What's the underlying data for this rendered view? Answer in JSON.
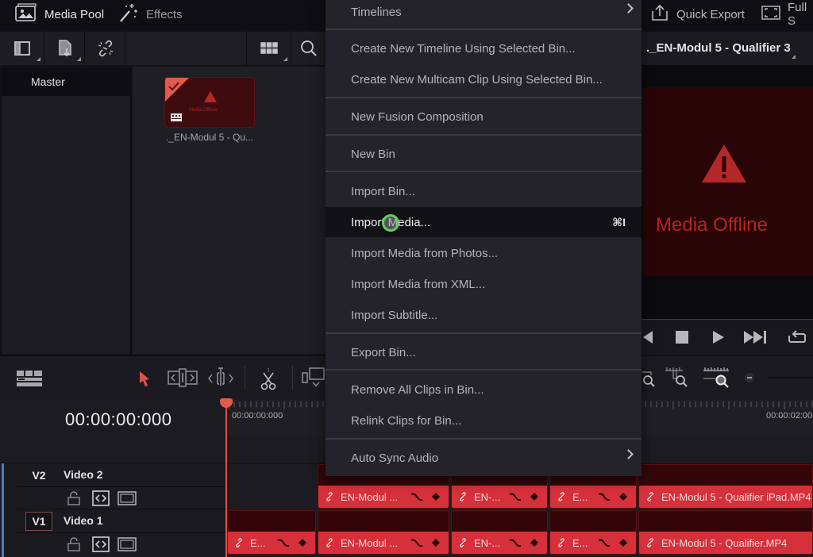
{
  "topbar": {
    "media_pool_label": "Media Pool",
    "effects_label": "Effects",
    "quick_export_label": "Quick Export",
    "full_label": "Full S"
  },
  "media_pool": {
    "bins": [
      {
        "label": "Master",
        "selected": true
      }
    ],
    "clips": [
      {
        "name": "._EN-Modul 5 - Qu...",
        "status": "Media Offline",
        "selected": true
      }
    ]
  },
  "context_menu": {
    "items": [
      {
        "label": "Timelines",
        "submenu": true
      },
      {
        "label": "Create New Timeline Using Selected Bin..."
      },
      {
        "label": "Create New Multicam Clip Using Selected Bin..."
      },
      {
        "label": "New Fusion Composition"
      },
      {
        "label": "New Bin"
      },
      {
        "label": "Import Bin..."
      },
      {
        "label": "Import Media...",
        "shortcut": "⌘I",
        "highlighted": true
      },
      {
        "label": "Import Media from Photos..."
      },
      {
        "label": "Import Media from XML..."
      },
      {
        "label": "Import Subtitle..."
      },
      {
        "label": "Export Bin..."
      },
      {
        "label": "Remove All Clips in Bin..."
      },
      {
        "label": "Relink Clips for Bin..."
      },
      {
        "label": "Auto Sync Audio",
        "submenu": true
      }
    ]
  },
  "viewer": {
    "title": "._EN-Modul 5 - Qualifier 3",
    "offline_text": "Media Offline"
  },
  "timeline": {
    "timecode": "00:00:00:000",
    "ruler_labels": [
      "00:00:00:000",
      "00:00:02:00"
    ],
    "tracks": [
      {
        "id": "V2",
        "name": "Video 2",
        "active": false
      },
      {
        "id": "V1",
        "name": "Video 1",
        "active": true
      }
    ],
    "clips_v2": [
      {
        "label": "EN-Modul ..."
      },
      {
        "label": "EN-..."
      },
      {
        "label": "E..."
      },
      {
        "label": "EN-Modul 5 - Qualifier iPad.MP4"
      }
    ],
    "clips_v1": [
      {
        "label": "E..."
      },
      {
        "label": "EN-Modul ..."
      },
      {
        "label": "EN-..."
      },
      {
        "label": "E..."
      },
      {
        "label": "EN-Modul 5 - Qualifier.MP4"
      }
    ]
  },
  "colors": {
    "accent_red": "#d6303a",
    "playhead": "#e0524a",
    "offline_red": "#b22424",
    "cursor_ring": "#5fcf5f"
  }
}
